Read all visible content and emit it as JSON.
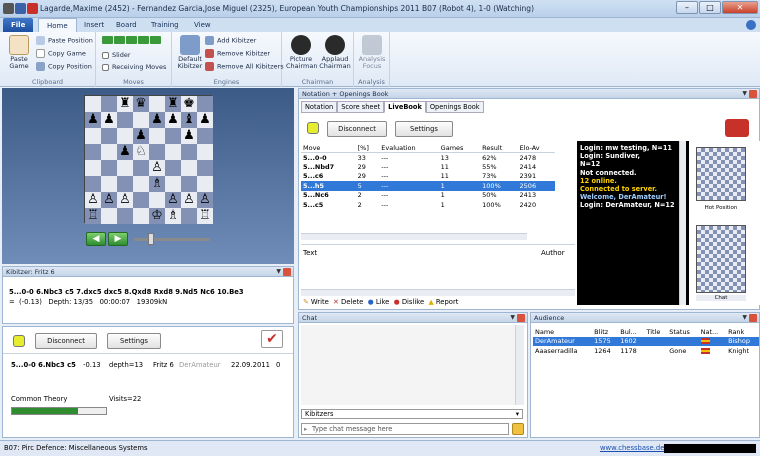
{
  "window": {
    "title": "Lagarde,Maxime (2452) - Fernandez Garcia,Jose Miguel (2325), European Youth Championships 2011  B07  (Robot 4), 1-0 (Watching)",
    "minimize": "–",
    "maximize": "□",
    "close": "✕"
  },
  "tabs": [
    "File",
    "Home",
    "Insert",
    "Board",
    "Training",
    "View"
  ],
  "ribbon": {
    "clipboard": {
      "paste_game": "Paste Game",
      "paste_position": "Paste Position",
      "copy_game": "Copy Game",
      "copy_position": "Copy Position",
      "label": "Clipboard"
    },
    "moves": {
      "slider": "Slider",
      "receiving_moves": "Receiving Moves",
      "label": "Moves"
    },
    "engines": {
      "default_kibitzer": "Default Kibitzer",
      "add_kibitzer": "Add Kibitzer",
      "remove_kibitzer": "Remove Kibitzer",
      "remove_all": "Remove All Kibitzers",
      "label": "Engines"
    },
    "chairman": {
      "picture": "Picture Chairman",
      "applaud": "Applaud Chairman",
      "label": "Chairman"
    },
    "analysis": {
      "focus": "Analysis Focus",
      "label": "Analysis"
    }
  },
  "board": {
    "rows": [
      [
        "",
        "",
        "♜",
        "♛",
        "",
        "♜",
        "♚",
        ""
      ],
      [
        "♟",
        "♟",
        "",
        "",
        "♟",
        "♟",
        "♝",
        "♟"
      ],
      [
        "",
        "",
        "",
        "♟",
        "",
        "",
        "♟",
        ""
      ],
      [
        "",
        "",
        "♟",
        "♘",
        "",
        "",
        "",
        ""
      ],
      [
        "",
        "",
        "",
        "",
        "♙",
        "",
        "",
        ""
      ],
      [
        "",
        "",
        "",
        "",
        "♗",
        "",
        "",
        ""
      ],
      [
        "♙",
        "♙",
        "♙",
        "",
        "",
        "♙",
        "♙",
        "♙"
      ],
      [
        "♖",
        "",
        "",
        "",
        "♔",
        "♗",
        "",
        "♖"
      ]
    ]
  },
  "kibitzer": {
    "title": "Kibitzer: Fritz 6",
    "line1": "5...0-0 6.Nbc3 c5 7.dxc5 dxc5 8.Qxd8 Rxd8 9.Nd5 Nc6 10.Be3",
    "line2": "=  (-0.13)   Depth: 13/35   00:00:07   19309kN"
  },
  "engine": {
    "disconnect": "Disconnect",
    "settings": "Settings",
    "move": "5...0-0 6.Nbc3 c5",
    "eval": "-0.13",
    "depth": "depth=13",
    "engine_name": "Fritz 6",
    "user": "DerAmateur",
    "date": "22.09.2011",
    "zero": "0",
    "theory": "Common Theory",
    "visits": "Visits=22",
    "progress": 0.7
  },
  "notation": {
    "title": "Notation + Openings Book",
    "tabs": [
      "Notation",
      "Score sheet",
      "LiveBook",
      "Openings Book"
    ],
    "disconnect": "Disconnect",
    "settings": "Settings",
    "headers": [
      "Move",
      "[%]",
      "Evaluation",
      "Games",
      "Result",
      "Elo-Av"
    ],
    "rows": [
      [
        "5...0-0",
        "33",
        "---",
        "13",
        "62%",
        "2478"
      ],
      [
        "5...Nbd7",
        "29",
        "---",
        "11",
        "55%",
        "2414"
      ],
      [
        "5...c6",
        "29",
        "---",
        "11",
        "73%",
        "2391"
      ],
      [
        "5...h5",
        "5",
        "---",
        "1",
        "100%",
        "2506"
      ],
      [
        "5...Nc6",
        "2",
        "---",
        "1",
        "50%",
        "2413"
      ],
      [
        "5...c5",
        "2",
        "---",
        "1",
        "100%",
        "2420"
      ]
    ],
    "text_label": "Text",
    "author_label": "Author",
    "write": "Write",
    "delete": "Delete",
    "like": "Like",
    "dislike": "Dislike",
    "report": "Report"
  },
  "server_log": [
    {
      "text": "Login: mw testing, N=11",
      "color": "#ffffff"
    },
    {
      "text": "Login: Sundiver,",
      "color": "#ffffff"
    },
    {
      "text": "N=12",
      "color": "#ffffff"
    },
    {
      "text": "Not connected.",
      "color": "#ffffff"
    },
    {
      "text": "12 online.",
      "color": "#ffd400"
    },
    {
      "text": "Connected to server.",
      "color": "#ffd400"
    },
    {
      "text": "Welcome, DerAmateur!",
      "color": "#9fd0ff"
    },
    {
      "text": "Login: DerAmateur, N=12",
      "color": "#ffffff"
    }
  ],
  "thumbs": {
    "hot_position": "Hot Position",
    "chat": "Chat"
  },
  "chat": {
    "title": "Chat",
    "dropdown": "Kibitzers",
    "placeholder": "Type chat message here"
  },
  "audience": {
    "title": "Audience",
    "headers": [
      "Name",
      "Blitz",
      "Bul...",
      "Title",
      "Status",
      "Nat...",
      "Rank"
    ],
    "rows": [
      [
        "DerAmateur",
        "1575",
        "1602",
        "",
        "",
        "",
        "Bishop"
      ],
      [
        "Aaaserradilla",
        "1264",
        "1178",
        "",
        "Gone",
        "",
        "Knight"
      ]
    ]
  },
  "status": {
    "opening": "B07: Pirc Defence: Miscellaneous Systems",
    "link": "www.chessbase.de"
  },
  "colors": {
    "accent": "#3079d9",
    "brand_red": "#c8312a",
    "green": "#2f8d2f"
  }
}
